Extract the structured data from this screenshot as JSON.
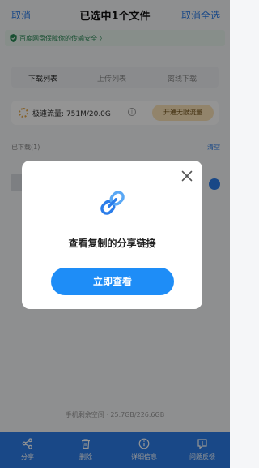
{
  "header": {
    "left_action": "取消",
    "title": "已选中1个文件",
    "right_action": "取消全选"
  },
  "security_banner": "百度网盘保障你的传输安全 〉",
  "tabs": [
    "下载列表",
    "上传列表",
    "离线下载"
  ],
  "speed": {
    "label": "极速流量: 751M/20.0G",
    "button": "开通无限流量"
  },
  "downloads": {
    "header": "已下载(1)",
    "clear": "清空"
  },
  "storage": "手机剩余空间 · 25.7GB/226.6GB",
  "bottom_nav": [
    {
      "label": "分享",
      "icon": "share-icon"
    },
    {
      "label": "删除",
      "icon": "trash-icon"
    },
    {
      "label": "详细信息",
      "icon": "info-icon"
    },
    {
      "label": "问题反馈",
      "icon": "feedback-icon"
    }
  ],
  "modal": {
    "icon": "link-icon",
    "message": "查看复制的分享链接",
    "button": "立即查看"
  },
  "colors": {
    "accent": "#2b7de9",
    "cta": "#1e8df7",
    "overlay": "rgba(0,0,0,0.42)"
  }
}
